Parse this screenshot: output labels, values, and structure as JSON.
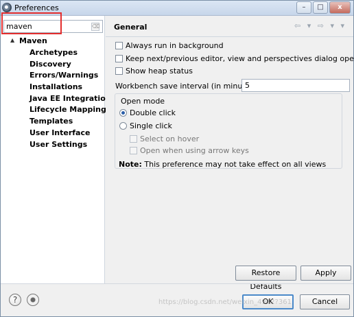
{
  "window": {
    "title": "Preferences",
    "controls": [
      "–",
      "□",
      "x"
    ]
  },
  "sidebar": {
    "filter_value": "maven",
    "filter_clear_icon": "⌫",
    "root": {
      "label": "Maven",
      "expanded_icon": "▲"
    },
    "children": [
      "Archetypes",
      "Discovery",
      "Errors/Warnings",
      "Installations",
      "Java EE Integration",
      "Lifecycle Mappings",
      "Templates",
      "User Interface",
      "User Settings"
    ]
  },
  "page": {
    "title": "General",
    "nav_icons": "⇦ ▾ ⇨ ▾ ▾",
    "options": [
      {
        "label": "Always run in background",
        "checked": false
      },
      {
        "label": "Keep next/previous editor, view and perspectives dialog open",
        "checked": false
      },
      {
        "label": "Show heap status",
        "checked": false
      }
    ],
    "interval_label": "Workbench save interval (in minutes):",
    "interval_value": "5",
    "open_mode": {
      "title": "Open mode",
      "double_click": "Double click",
      "single_click": "Single click",
      "select_on_hover": "Select on hover",
      "open_arrow_keys": "Open when using arrow keys",
      "note_bold": "Note:",
      "note_text": " This preference may not take effect on all views"
    },
    "restore_defaults": "Restore Defaults",
    "apply": "Apply"
  },
  "footer": {
    "help_icon": "?",
    "ok": "OK",
    "cancel": "Cancel",
    "watermark": "https://blog.csdn.net/weixin_4912?361"
  },
  "colors": {
    "highlight": "#e32d2d",
    "primary_button_border": "#4a89c9"
  }
}
